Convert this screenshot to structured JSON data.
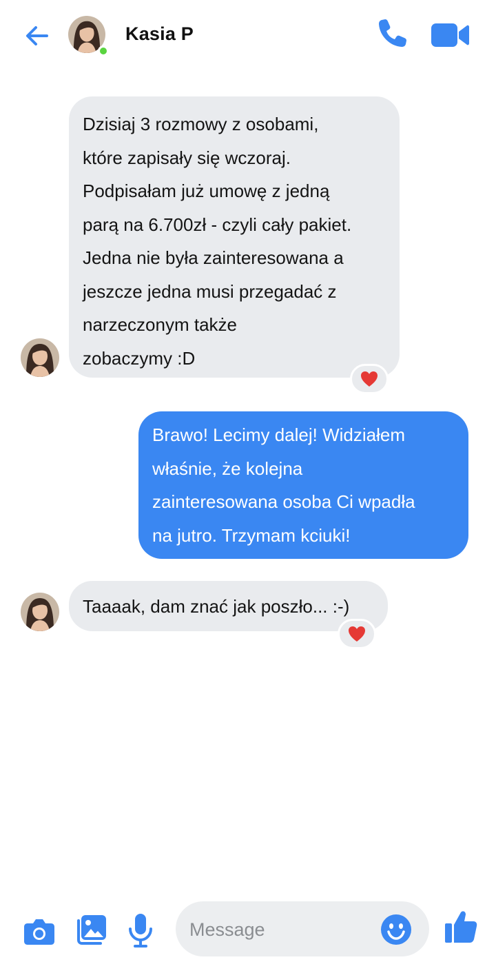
{
  "header": {
    "contact_name": "Kasia P",
    "online": true
  },
  "messages": [
    {
      "direction": "incoming",
      "lines": [
        "Dzisiaj 3 rozmowy z osobami,",
        "które zapisały się wczoraj.",
        "Podpisałam już umowę z jedną",
        "parą na 6.700zł - czyli cały pakiet.",
        "Jedna nie była zainteresowana a",
        "jeszcze jedna musi przegadać z",
        "narzeczonym także",
        "zobaczymy :D"
      ],
      "reaction": "heart"
    },
    {
      "direction": "outgoing",
      "lines": [
        "Brawo! Lecimy dalej! Widziałem",
        "właśnie, że kolejna",
        "zainteresowana osoba Ci wpadła",
        "na jutro. Trzymam kciuki!"
      ]
    },
    {
      "direction": "incoming",
      "lines": [
        "Taaaak, dam znać jak poszło... :-)"
      ],
      "reaction": "heart"
    }
  ],
  "composer": {
    "placeholder": "Message"
  },
  "icons": {
    "back": "arrow-left-icon",
    "call": "phone-icon",
    "video": "video-camera-icon",
    "camera": "camera-icon",
    "gallery": "image-icon",
    "mic": "microphone-icon",
    "emoji": "smiley-icon",
    "like": "thumbs-up-icon"
  },
  "colors": {
    "accent": "#3a87f2",
    "incoming_bubble": "#e9ebee",
    "online": "#5ad43f",
    "reaction_heart": "#e53935"
  }
}
